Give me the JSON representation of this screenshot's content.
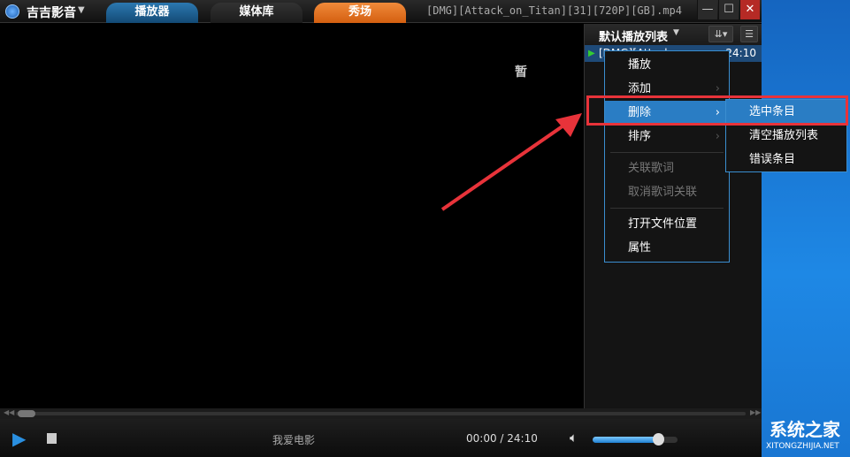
{
  "app": {
    "name": "吉吉影音",
    "tabs": [
      "播放器",
      "媒体库",
      "秀场"
    ],
    "file_title": "[DMG][Attack_on_Titan][31][720P][GB].mp4"
  },
  "window_controls": {
    "minimize": "—",
    "maximize": "☐",
    "close": "✕"
  },
  "video": {
    "status": "暂"
  },
  "playlist": {
    "title": "默认播放列表",
    "items": [
      {
        "name": "[DMG][Attack...",
        "duration": "24:10"
      }
    ]
  },
  "context_menu": {
    "items": [
      "播放",
      "添加",
      "删除",
      "排序",
      "关联歌词",
      "取消歌词关联",
      "打开文件位置",
      "属性"
    ]
  },
  "submenu": {
    "items": [
      "选中条目",
      "清空播放列表",
      "错误条目"
    ]
  },
  "controls": {
    "now_playing": "我爱电影",
    "time": "00:00 / 24:10",
    "volume_percent": 77,
    "seek_percent": 0
  },
  "watermark": {
    "text": "系统之家",
    "url": "XITONGZHIJIA.NET"
  },
  "colors": {
    "accent": "#2a7dc4",
    "highlight": "#e8333a",
    "tab_active": "#1d5b8c",
    "tab_show": "#e8731f"
  }
}
